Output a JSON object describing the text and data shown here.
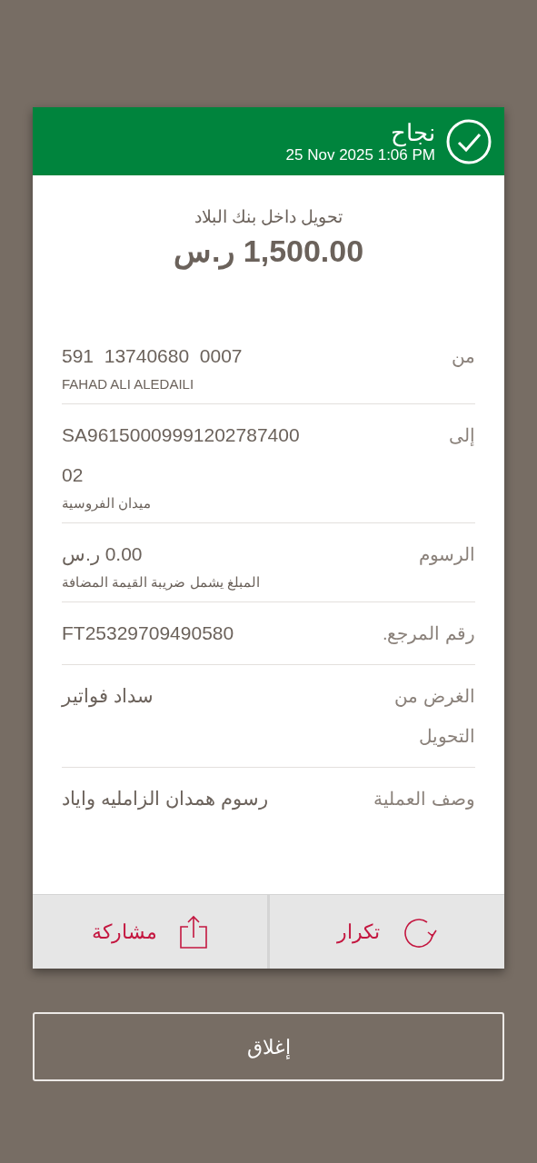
{
  "header": {
    "status": "نجاح",
    "datetime": "25 Nov 2025 1:06 PM"
  },
  "transfer": {
    "type": "تحويل داخل بنك البلاد",
    "amount": "1,500.00 ر.س"
  },
  "details": [
    {
      "label": "من",
      "value_lines": [
        "591  13740680  0007"
      ],
      "sub": "FAHAD ALI ALEDAILI"
    },
    {
      "label": "إلى",
      "value_lines": [
        "SA96150009991202787400",
        "02"
      ],
      "sub": "ميدان الفروسية"
    },
    {
      "label": "الرسوم",
      "value_lines": [
        "0.00 ر.س"
      ],
      "sub": "المبلغ يشمل ضريبة القيمة المضافة"
    },
    {
      "label": "رقم المرجع.",
      "value_lines": [
        "FT25329709490580"
      ]
    },
    {
      "label": "الغرض من التحويل",
      "value_lines": [
        "سداد فواتير"
      ]
    },
    {
      "label": "وصف العملية",
      "value_lines": [
        "رسوم همدان الزامليه واياد"
      ]
    }
  ],
  "actions": [
    {
      "kind": "repeat",
      "label": "تكرار"
    },
    {
      "kind": "share",
      "label": "مشاركة"
    }
  ],
  "close_button": "إغلاق"
}
